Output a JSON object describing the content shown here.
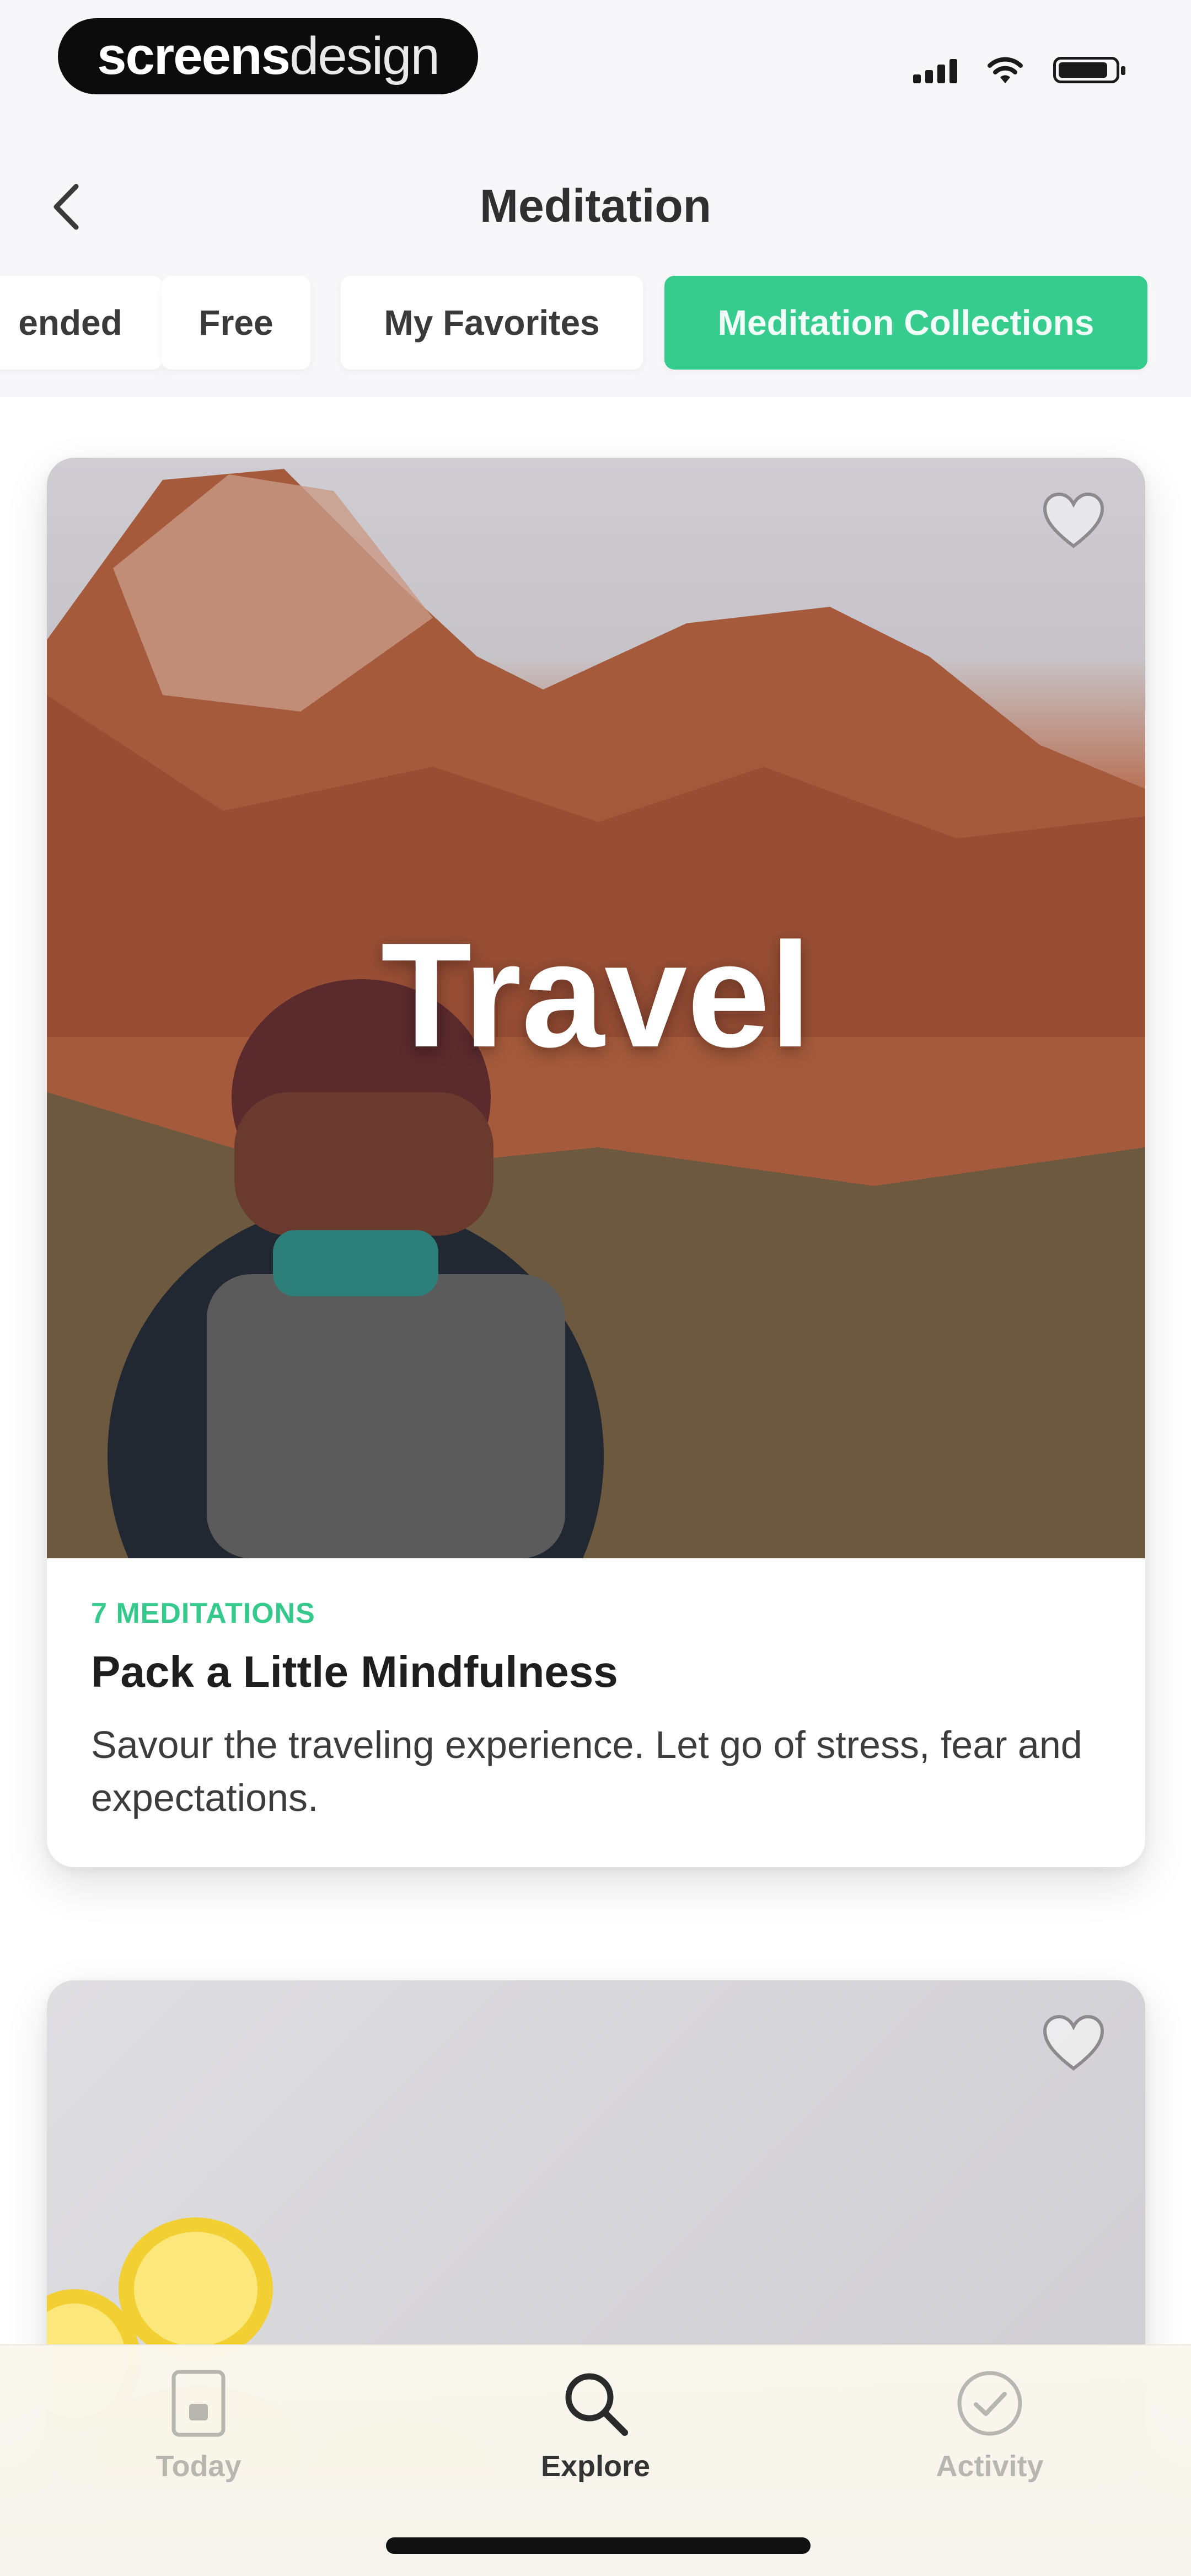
{
  "status_bar": {
    "brand_bold": "screens",
    "brand_light": "design"
  },
  "header": {
    "back_icon": "chevron-left-icon",
    "title": "Meditation"
  },
  "tabs": [
    {
      "label": "ended",
      "active": false
    },
    {
      "label": "Free",
      "active": false
    },
    {
      "label": "My Favorites",
      "active": false
    },
    {
      "label": "Meditation Collections",
      "active": true
    }
  ],
  "accent_color": "#36cc8d",
  "cards": [
    {
      "image_label": "Travel",
      "count_label": "7 MEDITATIONS",
      "title": "Pack a Little Mindfulness",
      "description": "Savour the traveling experience. Let go of stress, fear and expectations.",
      "favorite_icon": "heart-icon"
    },
    {
      "favorite_icon": "heart-icon"
    }
  ],
  "tab_bar": {
    "items": [
      {
        "label": "Today",
        "icon": "today-icon",
        "active": false
      },
      {
        "label": "Explore",
        "icon": "search-icon",
        "active": true
      },
      {
        "label": "Activity",
        "icon": "check-circle-icon",
        "active": false
      }
    ]
  }
}
